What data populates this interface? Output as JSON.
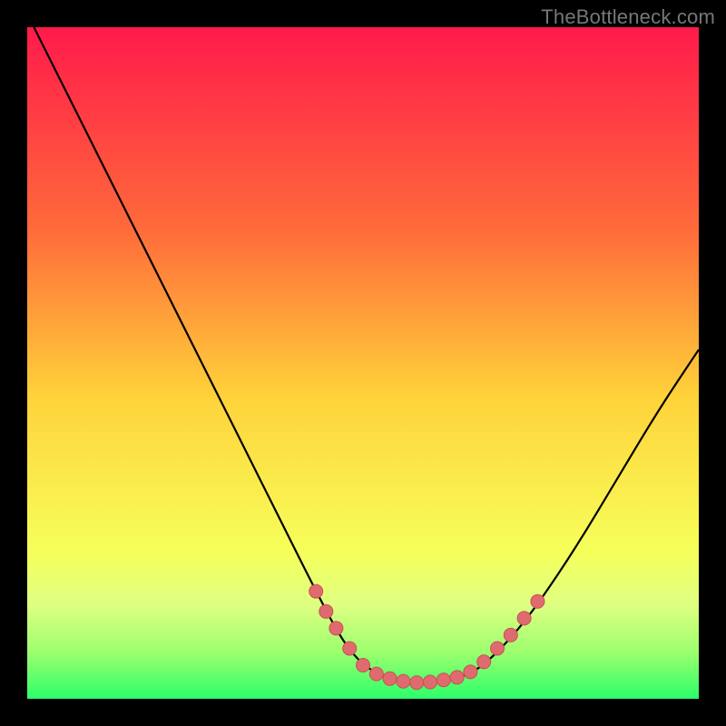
{
  "watermark": "TheBottleneck.com",
  "colors": {
    "page_bg": "#000000",
    "gradient_top": "#ff1a4b",
    "gradient_mid_upper": "#ff8c2e",
    "gradient_mid": "#ffe62e",
    "gradient_lower": "#f6ff5a",
    "gradient_band": "#dfff82",
    "gradient_bottom": "#2cff6b",
    "curve": "#000000",
    "dot_fill": "#e06b6f",
    "dot_stroke": "#c94f55"
  },
  "chart_data": {
    "type": "line",
    "title": "",
    "xlabel": "",
    "ylabel": "",
    "xlim": [
      0,
      100
    ],
    "ylim": [
      0,
      100
    ],
    "gradient_stops": [
      {
        "offset": 0.0,
        "color": "#ff1a4b"
      },
      {
        "offset": 0.3,
        "color": "#ff6a3a"
      },
      {
        "offset": 0.55,
        "color": "#ffd23a"
      },
      {
        "offset": 0.78,
        "color": "#f6ff5a"
      },
      {
        "offset": 0.86,
        "color": "#dfff82"
      },
      {
        "offset": 0.93,
        "color": "#9dff6e"
      },
      {
        "offset": 1.0,
        "color": "#2cff6b"
      }
    ],
    "curve": [
      {
        "x": 1.0,
        "y": 100.0
      },
      {
        "x": 4.0,
        "y": 94.0
      },
      {
        "x": 8.0,
        "y": 86.0
      },
      {
        "x": 14.0,
        "y": 74.0
      },
      {
        "x": 20.0,
        "y": 62.0
      },
      {
        "x": 26.0,
        "y": 50.0
      },
      {
        "x": 32.0,
        "y": 38.0
      },
      {
        "x": 38.0,
        "y": 26.0
      },
      {
        "x": 43.0,
        "y": 16.0
      },
      {
        "x": 47.0,
        "y": 8.5
      },
      {
        "x": 50.0,
        "y": 5.0
      },
      {
        "x": 53.0,
        "y": 3.3
      },
      {
        "x": 56.0,
        "y": 2.6
      },
      {
        "x": 59.0,
        "y": 2.4
      },
      {
        "x": 62.0,
        "y": 2.6
      },
      {
        "x": 65.0,
        "y": 3.3
      },
      {
        "x": 68.0,
        "y": 5.0
      },
      {
        "x": 72.0,
        "y": 9.0
      },
      {
        "x": 76.0,
        "y": 14.0
      },
      {
        "x": 82.0,
        "y": 23.0
      },
      {
        "x": 88.0,
        "y": 33.0
      },
      {
        "x": 94.0,
        "y": 43.0
      },
      {
        "x": 100.0,
        "y": 52.0
      }
    ],
    "dots": [
      {
        "x": 43.0,
        "y": 16.0
      },
      {
        "x": 44.5,
        "y": 13.0
      },
      {
        "x": 46.0,
        "y": 10.5
      },
      {
        "x": 48.0,
        "y": 7.5
      },
      {
        "x": 50.0,
        "y": 5.0
      },
      {
        "x": 52.0,
        "y": 3.7
      },
      {
        "x": 54.0,
        "y": 3.0
      },
      {
        "x": 56.0,
        "y": 2.6
      },
      {
        "x": 58.0,
        "y": 2.4
      },
      {
        "x": 60.0,
        "y": 2.5
      },
      {
        "x": 62.0,
        "y": 2.8
      },
      {
        "x": 64.0,
        "y": 3.2
      },
      {
        "x": 66.0,
        "y": 4.0
      },
      {
        "x": 68.0,
        "y": 5.5
      },
      {
        "x": 70.0,
        "y": 7.5
      },
      {
        "x": 72.0,
        "y": 9.5
      },
      {
        "x": 74.0,
        "y": 12.0
      },
      {
        "x": 76.0,
        "y": 14.5
      }
    ]
  }
}
